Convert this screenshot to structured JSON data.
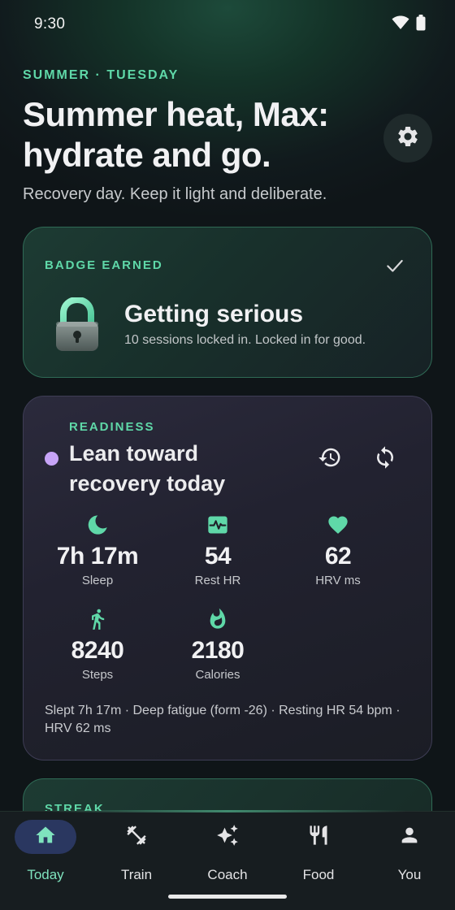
{
  "status_bar": {
    "time": "9:30",
    "icons": [
      "wifi-icon",
      "battery-icon"
    ]
  },
  "header": {
    "eyebrow": "SUMMER · TUESDAY",
    "headline": "Summer heat, Max: hydrate and go.",
    "subtitle": "Recovery day. Keep it light and deliberate.",
    "settings_icon": "gear-icon"
  },
  "badge_card": {
    "eyebrow": "BADGE EARNED",
    "title": "Getting serious",
    "subtitle": "10 sessions locked in. Locked in for good.",
    "icon": "lock-icon",
    "check_icon": "check-icon"
  },
  "readiness": {
    "eyebrow": "READINESS",
    "title": "Lean toward recovery today",
    "status_color": "#C7A4F7",
    "actions": [
      "history-icon",
      "refresh-icon"
    ],
    "metrics": [
      {
        "icon": "moon-icon",
        "value": "7h 17m",
        "label": "Sleep"
      },
      {
        "icon": "heart-monitor-icon",
        "value": "54",
        "label": "Rest HR"
      },
      {
        "icon": "heart-icon",
        "value": "62",
        "label": "HRV ms"
      },
      {
        "icon": "walking-icon",
        "value": "8240",
        "label": "Steps"
      },
      {
        "icon": "flame-icon",
        "value": "2180",
        "label": "Calories"
      }
    ],
    "summary": "Slept 7h 17m · Deep fatigue (form -26) · Resting HR 54 bpm · HRV 62 ms"
  },
  "streak_card": {
    "eyebrow": "STREAK"
  },
  "bottom_nav": {
    "active": "Today",
    "items": [
      {
        "label": "Today",
        "icon": "home-icon"
      },
      {
        "label": "Train",
        "icon": "dumbbell-icon"
      },
      {
        "label": "Coach",
        "icon": "sparkles-icon"
      },
      {
        "label": "Food",
        "icon": "utensils-icon"
      },
      {
        "label": "You",
        "icon": "person-icon"
      }
    ]
  },
  "colors": {
    "accent": "#5FD8A8",
    "nav_active_pill": "#2a3760",
    "background": "#101518"
  }
}
